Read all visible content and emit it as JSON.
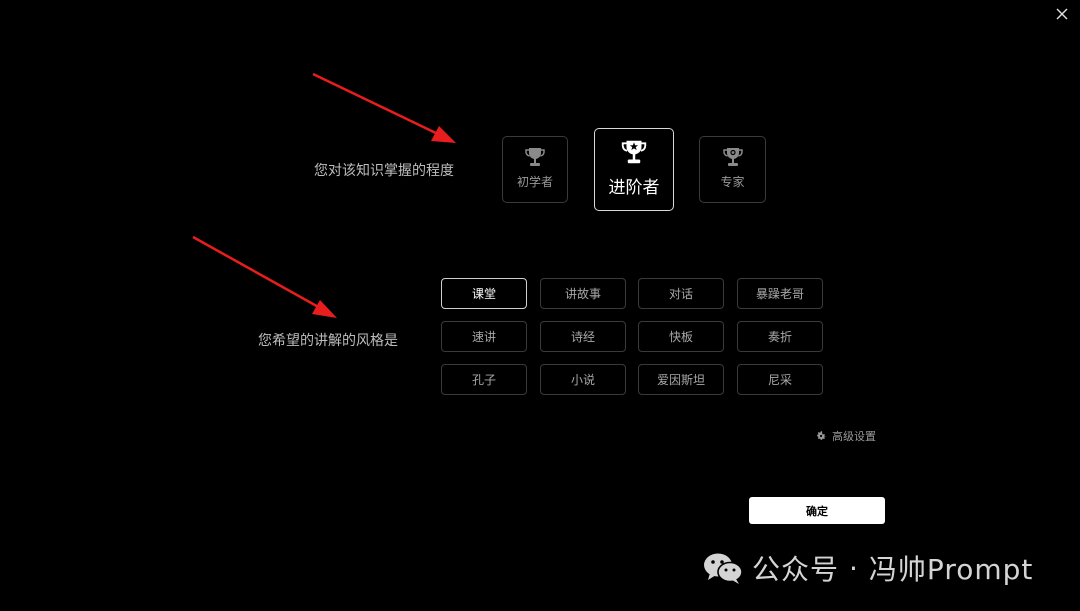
{
  "window": {
    "close_icon": "close-icon"
  },
  "level": {
    "prompt": "您对该知识掌握的程度",
    "options": [
      {
        "label": "初学者",
        "icon": "trophy-icon",
        "selected": false
      },
      {
        "label": "进阶者",
        "icon": "trophy-star-icon",
        "selected": true
      },
      {
        "label": "专家",
        "icon": "trophy-medal-icon",
        "selected": false
      }
    ]
  },
  "style": {
    "prompt": "您希望的讲解的风格是",
    "options": [
      {
        "label": "课堂",
        "selected": true
      },
      {
        "label": "讲故事",
        "selected": false
      },
      {
        "label": "对话",
        "selected": false
      },
      {
        "label": "暴躁老哥",
        "selected": false
      },
      {
        "label": "速讲",
        "selected": false
      },
      {
        "label": "诗经",
        "selected": false
      },
      {
        "label": "快板",
        "selected": false
      },
      {
        "label": "奏折",
        "selected": false
      },
      {
        "label": "孔子",
        "selected": false
      },
      {
        "label": "小说",
        "selected": false
      },
      {
        "label": "爱因斯坦",
        "selected": false
      },
      {
        "label": "尼采",
        "selected": false
      }
    ]
  },
  "advanced_settings": {
    "label": "高级设置",
    "icon": "gear-icon"
  },
  "confirm": {
    "label": "确定"
  },
  "watermark": {
    "icon": "wechat-icon",
    "prefix": "公众号",
    "separator": "·",
    "name": "冯帅Prompt"
  },
  "colors": {
    "background": "#000000",
    "arrow": "#e81d1d",
    "confirm_bg": "#ffffff"
  }
}
